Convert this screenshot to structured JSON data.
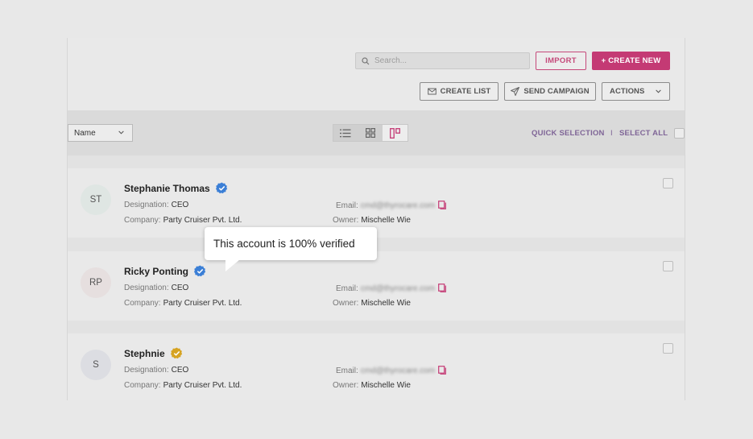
{
  "header": {
    "search_placeholder": "Search...",
    "import_label": "IMPORT",
    "create_new_label": "+ CREATE NEW",
    "create_list_label": "CREATE LIST",
    "send_campaign_label": "SEND CAMPAIGN",
    "actions_label": "ACTIONS"
  },
  "toolbar": {
    "sort_value": "Name",
    "quick_selection_label": "QUICK SELECTION",
    "separator": "I",
    "select_all_label": "SELECT ALL"
  },
  "labels": {
    "designation": "Designation:",
    "company": "Company:",
    "email": "Email:",
    "owner": "Owner:"
  },
  "contacts": [
    {
      "initials": "ST",
      "name": "Stephanie Thomas",
      "designation": "CEO",
      "company": "Party Cruiser Pvt. Ltd.",
      "email": "cmd@thyrocare.com",
      "owner": "Mischelle Wie",
      "badge_color": "#3b7fd6",
      "avatar_bg": "#dfe6e3"
    },
    {
      "initials": "RP",
      "name": "Ricky Ponting",
      "designation": "CEO",
      "company": "Party Cruiser Pvt. Ltd.",
      "email": "cmd@thyrocare.com",
      "owner": "Mischelle Wie",
      "badge_color": "#3b7fd6",
      "avatar_bg": "#e6dfdf"
    },
    {
      "initials": "S",
      "name": "Stephnie",
      "designation": "CEO",
      "company": "Party Cruiser Pvt. Ltd.",
      "email": "cmd@thyrocare.com",
      "owner": "Mischelle Wie",
      "badge_color": "#d6a321",
      "avatar_bg": "#dcdde2"
    }
  ],
  "tooltip": {
    "text": "This account is 100% verified"
  },
  "colors": {
    "accent": "#c43a74",
    "link": "#7f6597",
    "verified_blue": "#3b7fd6",
    "verified_gold": "#d6a321"
  }
}
